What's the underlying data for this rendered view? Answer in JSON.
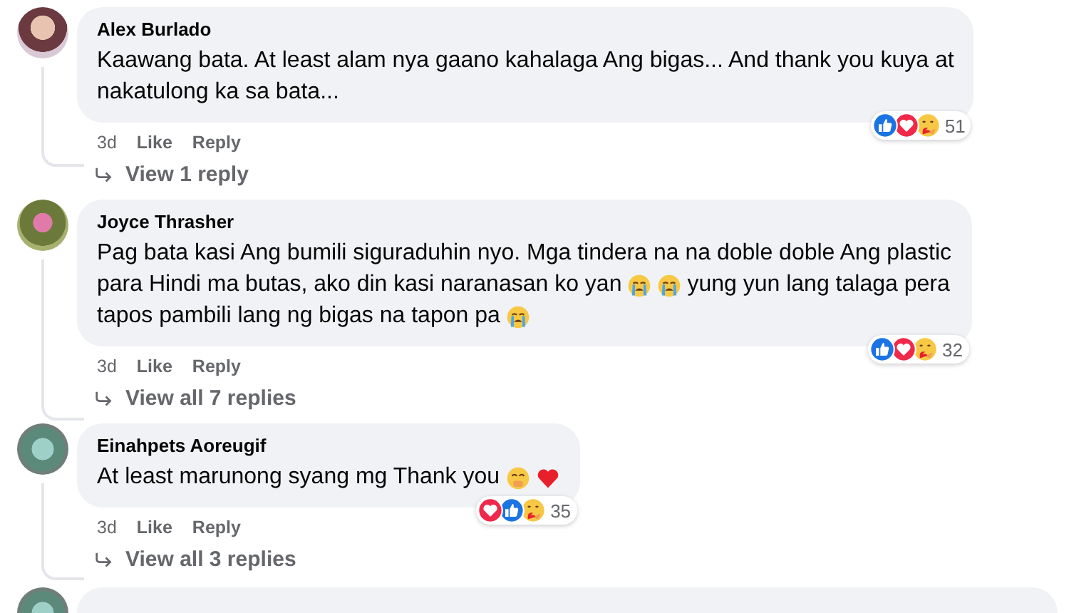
{
  "comments": [
    {
      "author": "Alex Burlado",
      "lines": [
        [
          {
            "kind": "text",
            "text": "Kaawang bata. At least alam nya gaano kahalaga Ang bigas... And thank you kuya at"
          }
        ],
        [
          {
            "kind": "text",
            "text": "nakatulong ka sa bata..."
          }
        ]
      ],
      "reactions": [
        {
          "kind": "like"
        },
        {
          "kind": "love"
        },
        {
          "kind": "care"
        }
      ],
      "reaction_count": "51",
      "time": "3d",
      "like": "Like",
      "reply": "Reply",
      "replies_link": "View 1 reply"
    },
    {
      "author": "Joyce Thrasher",
      "lines": [
        [
          {
            "kind": "text",
            "text": "Pag bata kasi Ang bumili siguraduhin nyo. Mga tindera na na doble doble Ang plastic"
          }
        ],
        [
          {
            "kind": "text",
            "text": "para Hindi ma butas, ako din kasi naranasan ko yan"
          },
          {
            "kind": "crying"
          },
          {
            "kind": "crying"
          },
          {
            "kind": "text",
            "text": "yung yun lang talaga pera"
          }
        ],
        [
          {
            "kind": "text",
            "text": "tapos pambili lang ng bigas na tapon pa"
          },
          {
            "kind": "crying"
          }
        ]
      ],
      "reactions": [
        {
          "kind": "like"
        },
        {
          "kind": "love"
        },
        {
          "kind": "care"
        }
      ],
      "reaction_count": "32",
      "time": "3d",
      "like": "Like",
      "reply": "Reply",
      "replies_link": "View all 7 replies"
    },
    {
      "author": "Einahpets Aoreugif",
      "lines": [
        [
          {
            "kind": "text",
            "text": "At least marunong syang mg Thank you"
          },
          {
            "kind": "blush"
          },
          {
            "kind": "heart"
          }
        ]
      ],
      "reactions": [
        {
          "kind": "love"
        },
        {
          "kind": "like"
        },
        {
          "kind": "care"
        }
      ],
      "reaction_count": "35",
      "time": "3d",
      "like": "Like",
      "reply": "Reply",
      "replies_link": "View all 3 replies"
    }
  ],
  "next_comment": {
    "kind": "cut_off"
  }
}
